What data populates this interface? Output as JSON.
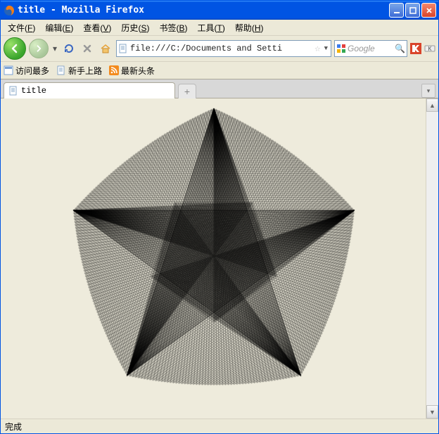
{
  "window": {
    "title": "title - Mozilla Firefox"
  },
  "menu": {
    "file": {
      "label": "文件",
      "accel": "F"
    },
    "edit": {
      "label": "编辑",
      "accel": "E"
    },
    "view": {
      "label": "查看",
      "accel": "V"
    },
    "history": {
      "label": "历史",
      "accel": "S"
    },
    "bookmarks": {
      "label": "书签",
      "accel": "B"
    },
    "tools": {
      "label": "工具",
      "accel": "T"
    },
    "help": {
      "label": "帮助",
      "accel": "H"
    }
  },
  "nav": {
    "url": "file:///C:/Documents and Setti",
    "search_placeholder": "Google"
  },
  "bookmarks_bar": {
    "most_visited": "访问最多",
    "getting_started": "新手上路",
    "latest_headlines": "最新头条"
  },
  "tabs": {
    "active_label": "title",
    "new_tab_glyph": "+"
  },
  "status": {
    "text": "完成"
  },
  "canvas_art": {
    "description": "String-art / spirograph pentagonal star made of dense black line segments",
    "segments_per_lobe": 60,
    "lobes": 5,
    "stroke": "#000000"
  }
}
